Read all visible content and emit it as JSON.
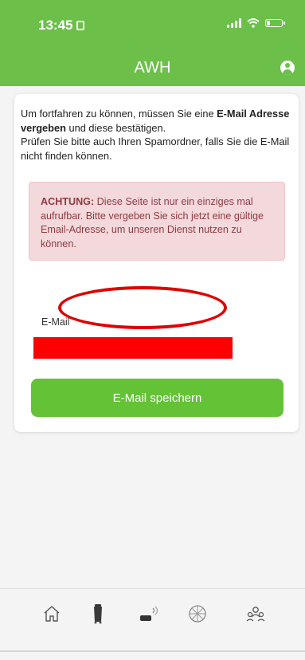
{
  "status_bar": {
    "time": "13:45"
  },
  "app_bar": {
    "title": "AWH"
  },
  "card": {
    "intro_part1": "Um fortfahren zu können, müssen Sie eine ",
    "intro_bold": "E-Mail Adresse vergeben",
    "intro_part2": " und diese bestätigen.",
    "intro_line2": "Prüfen Sie bitte auch Ihren Spamordner, falls Sie die E-Mail nicht finden können.",
    "alert_label": "ACHTUNG:",
    "alert_text": " Diese Seite ist nur ein einziges mal aufrufbar. Bitte vergeben Sie sich jetzt eine gültige Email-Adresse, um unseren Dienst nutzen zu können.",
    "email_label": "E-Mail",
    "email_value": "",
    "save_label": "E-Mail speichern"
  },
  "nav": {
    "items": [
      {
        "icon": "home-icon"
      },
      {
        "icon": "bin-icon"
      },
      {
        "icon": "wifi-sensor-icon"
      },
      {
        "icon": "network-icon"
      },
      {
        "icon": "people-icon"
      }
    ]
  },
  "colors": {
    "brand_green": "#6cc04a",
    "button_green": "#63c235",
    "alert_bg": "#f3d9dc",
    "alert_text": "#8e3a40",
    "annotation_red": "#e00000"
  }
}
